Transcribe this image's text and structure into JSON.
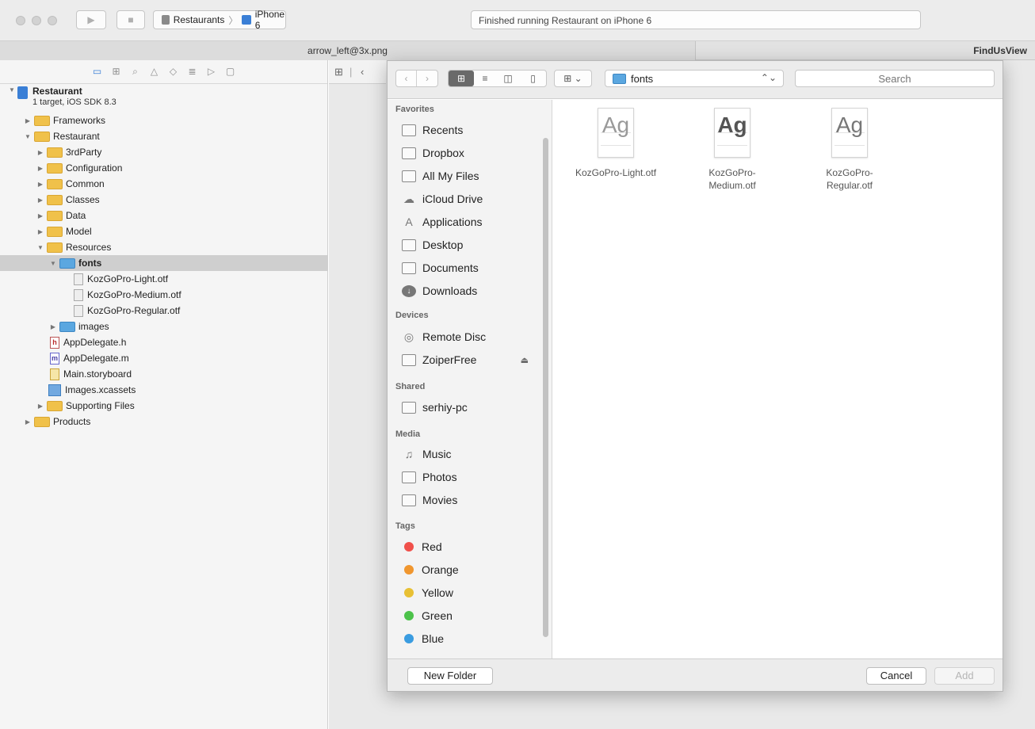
{
  "toolbar": {
    "scheme_target": "Restaurants",
    "scheme_separator": "〉",
    "scheme_device": "iPhone 6",
    "status": "Finished running Restaurant on iPhone 6",
    "run_glyph": "▶",
    "stop_glyph": "■"
  },
  "tabs": [
    "arrow_left@3x.png",
    "FindUsView"
  ],
  "navigator": {
    "tab_icons": [
      "folder-icon",
      "hierarchy-icon",
      "search-icon",
      "warning-icon",
      "test-icon",
      "debug-icon",
      "breakpoint-icon",
      "report-icon"
    ],
    "project": {
      "name": "Restaurant",
      "subtitle": "1 target, iOS SDK 8.3"
    },
    "items": [
      {
        "label": "Frameworks",
        "level": 1,
        "kind": "folder",
        "state": "collapsed"
      },
      {
        "label": "Restaurant",
        "level": 1,
        "kind": "folder",
        "state": "expanded"
      },
      {
        "label": "3rdParty",
        "level": 2,
        "kind": "folder",
        "state": "collapsed"
      },
      {
        "label": "Configuration",
        "level": 2,
        "kind": "folder",
        "state": "collapsed"
      },
      {
        "label": "Common",
        "level": 2,
        "kind": "folder",
        "state": "collapsed"
      },
      {
        "label": "Classes",
        "level": 2,
        "kind": "folder",
        "state": "collapsed"
      },
      {
        "label": "Data",
        "level": 2,
        "kind": "folder",
        "state": "collapsed"
      },
      {
        "label": "Model",
        "level": 2,
        "kind": "folder",
        "state": "collapsed"
      },
      {
        "label": "Resources",
        "level": 2,
        "kind": "folder",
        "state": "expanded"
      },
      {
        "label": "fonts",
        "level": 3,
        "kind": "folder-blue",
        "state": "expanded",
        "selected": true
      },
      {
        "label": "KozGoPro-Light.otf",
        "level": 4,
        "kind": "otf"
      },
      {
        "label": "KozGoPro-Medium.otf",
        "level": 4,
        "kind": "otf"
      },
      {
        "label": "KozGoPro-Regular.otf",
        "level": 4,
        "kind": "otf"
      },
      {
        "label": "images",
        "level": 3,
        "kind": "folder-blue",
        "state": "collapsed"
      },
      {
        "label": "AppDelegate.h",
        "level": 2,
        "kind": "h"
      },
      {
        "label": "AppDelegate.m",
        "level": 2,
        "kind": "m"
      },
      {
        "label": "Main.storyboard",
        "level": 2,
        "kind": "sb"
      },
      {
        "label": "Images.xcassets",
        "level": 2,
        "kind": "xa"
      },
      {
        "label": "Supporting Files",
        "level": 2,
        "kind": "folder",
        "state": "collapsed"
      },
      {
        "label": "Products",
        "level": 1,
        "kind": "folder",
        "state": "collapsed"
      }
    ]
  },
  "dialog": {
    "path": "fonts",
    "search_placeholder": "Search",
    "sections": {
      "favorites": {
        "title": "Favorites",
        "items": [
          "Recents",
          "Dropbox",
          "All My Files",
          "iCloud Drive",
          "Applications",
          "Desktop",
          "Documents",
          "Downloads"
        ]
      },
      "devices": {
        "title": "Devices",
        "items": [
          "Remote Disc",
          "ZoiperFree"
        ]
      },
      "shared": {
        "title": "Shared",
        "items": [
          "serhiy-pc"
        ]
      },
      "media": {
        "title": "Media",
        "items": [
          "Music",
          "Photos",
          "Movies"
        ]
      },
      "tags": {
        "title": "Tags",
        "items": [
          {
            "label": "Red",
            "color": "#f0504a"
          },
          {
            "label": "Orange",
            "color": "#f0962e"
          },
          {
            "label": "Yellow",
            "color": "#e8c034"
          },
          {
            "label": "Green",
            "color": "#4cc24a"
          },
          {
            "label": "Blue",
            "color": "#3a9ce0"
          }
        ]
      }
    },
    "files": [
      {
        "line1": "KozGoPro-Light.otf",
        "line2": "",
        "preview": "Ag"
      },
      {
        "line1": "KozGoPro-",
        "line2": "Medium.otf",
        "preview": "Ag"
      },
      {
        "line1": "KozGoPro-",
        "line2": "Regular.otf",
        "preview": "Ag"
      }
    ],
    "buttons": {
      "new_folder": "New Folder",
      "cancel": "Cancel",
      "add": "Add"
    }
  }
}
